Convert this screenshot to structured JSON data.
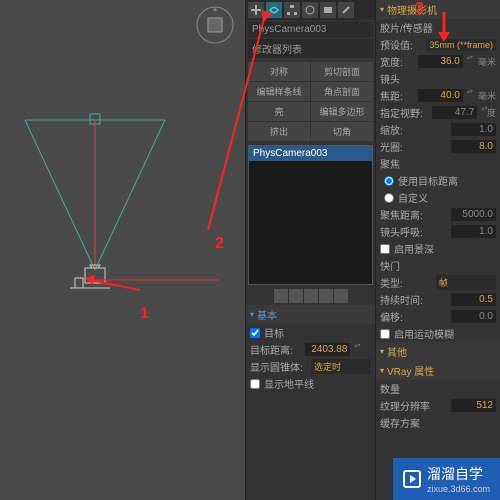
{
  "viewport": {
    "object_name": "PhysCamera003"
  },
  "annotations": {
    "a1": "1",
    "a2": "2",
    "a3": "3"
  },
  "panel_left": {
    "modifier_list": "修改器列表",
    "grid": {
      "symmetry": "对称",
      "shear_section": "剪切剖面",
      "edit_spline": "编辑样条线",
      "corner_section": "角点剖面",
      "shell": "壳",
      "edit_mesh": "编辑多边形",
      "extrude": "挤出",
      "chamfer": "切角"
    },
    "basic_hdr": "基本",
    "target_check": "目标",
    "target_dist_lbl": "目标距离:",
    "target_dist_val": "2403.88",
    "show_cone_lbl": "显示圆锥体:",
    "show_cone_val": "选定时",
    "show_horizon": "显示地平线"
  },
  "panel_right": {
    "phys_camera_hdr": "物理摄影机",
    "film_sensor": "胶片/传感器",
    "preset_lbl": "预设值:",
    "preset_val": "35mm (**frame)",
    "width_lbl": "宽度:",
    "width_val": "36.0",
    "width_unit": "毫米",
    "lens": "镜头",
    "focal_lbl": "焦距:",
    "focal_val": "40.0",
    "focal_unit": "毫米",
    "fov_lbl": "指定视野:",
    "fov_val": "47.7",
    "fov_unit": "度",
    "zoom_lbl": "缩放:",
    "zoom_val": "1.0",
    "aperture_lbl": "光圈:",
    "aperture_val": "8.0",
    "focus": "聚焦",
    "use_target": "使用目标距离",
    "custom": "自定义",
    "focus_dist_lbl": "聚焦距离:",
    "focus_dist_val": "5000.0",
    "lens_breathe_lbl": "镜头呼吸:",
    "lens_breathe_val": "1.0",
    "enable_dof": "启用景深",
    "shutter": "快门",
    "type_lbl": "类型:",
    "type_val": "帧",
    "duration_lbl": "持续时间:",
    "duration_val": "0.5",
    "offset_lbl": "偏移:",
    "offset_val": "0.0",
    "motion_blur": "启用运动模糊",
    "misc_hdr": "其他",
    "vray_attr_hdr": "VRay 属性",
    "count_lbl": "数量",
    "tex_res_lbl": "纹理分辨率",
    "tex_res_val": "512",
    "cache_lbl": "缓存方案"
  },
  "watermark": {
    "brand": "溜溜自学",
    "url": "zixue.3d66.com"
  }
}
